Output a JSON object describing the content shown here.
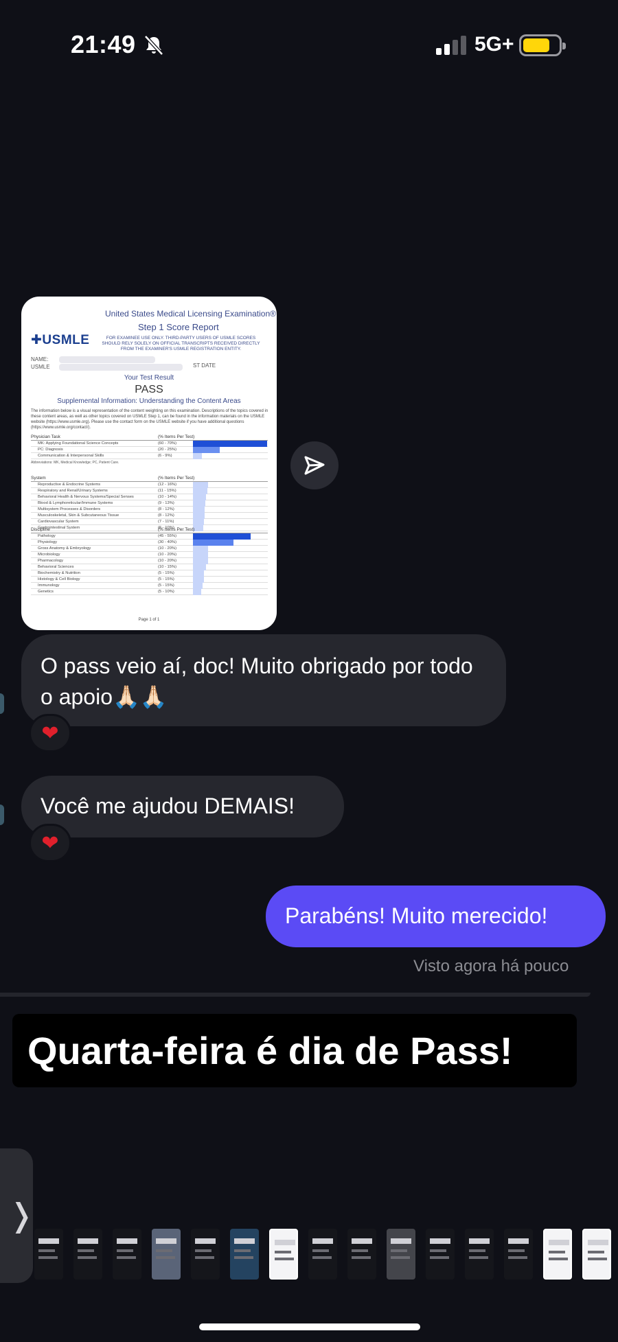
{
  "status_bar": {
    "time": "21:49",
    "network": "5G+",
    "mute_icon": "bell-slash-icon",
    "battery_color": "#ffd60a"
  },
  "attachment": {
    "title_line1": "United States Medical Licensing Examination®",
    "title_line2": "Step 1 Score Report",
    "logo": "USMLE",
    "warning": "FOR EXAMINEE USE ONLY. THIRD-PARTY USERS OF USMLE SCORES SHOULD RELY SOLELY ON OFFICIAL TRANSCRIPTS RECEIVED DIRECTLY FROM THE EXAMINER'S USMLE REGISTRATION ENTITY.",
    "name_label": "NAME:",
    "usmle_label": "USMLE",
    "date_label": "ST DATE",
    "your_test_result": "Your Test Result",
    "result": "PASS",
    "supplemental": "Supplemental Information: Understanding the Content Areas",
    "intro": "The information below is a visual representation of the content weighting on this examination. Descriptions of the topics covered in these content areas, as well as other topics covered on USMLE Step 1, can be found in the information materials on the USMLE website (https://www.usmle.org). Please use the contact form on the USMLE website if you have additional questions (https://www.usmle.org/contact/).",
    "sections": [
      {
        "heading": "Physician Task",
        "col": "(% Items Per Test)",
        "rows": [
          {
            "name": "MK: Applying Foundational Science Concepts",
            "range": "(60 - 70%)",
            "pct": 100,
            "color": "#1f4fd6"
          },
          {
            "name": "PC: Diagnosis",
            "range": "(20 - 25%)",
            "pct": 36,
            "color": "#6a8ff0"
          },
          {
            "name": "Communication & Interpersonal Skills",
            "range": "(6 - 9%)",
            "pct": 12,
            "color": "#c7d5fa"
          }
        ],
        "note": "Abbreviations: MK, Medical Knowledge; PC, Patient Care."
      },
      {
        "heading": "System",
        "col": "(% Items Per Test)",
        "rows": [
          {
            "name": "Reproductive & Endocrine Systems",
            "range": "(12 - 16%)",
            "pct": 20,
            "color": "#c7d5fa"
          },
          {
            "name": "Respiratory and Renal/Urinary Systems",
            "range": "(11 - 15%)",
            "pct": 19,
            "color": "#c7d5fa"
          },
          {
            "name": "Behavioral Health & Nervous Systems/Special Senses",
            "range": "(10 - 14%)",
            "pct": 18,
            "color": "#c7d5fa"
          },
          {
            "name": "Blood & Lymphoreticular/Immune Systems",
            "range": "(9 - 13%)",
            "pct": 17,
            "color": "#c7d5fa"
          },
          {
            "name": "Multisystem Processes & Disorders",
            "range": "(8 - 12%)",
            "pct": 16,
            "color": "#c7d5fa"
          },
          {
            "name": "Musculoskeletal, Skin & Subcutaneous Tissue",
            "range": "(8 - 12%)",
            "pct": 16,
            "color": "#c7d5fa"
          },
          {
            "name": "Cardiovascular System",
            "range": "(7 - 11%)",
            "pct": 15,
            "color": "#c7d5fa"
          },
          {
            "name": "Gastrointestinal System",
            "range": "(6 - 10%)",
            "pct": 14,
            "color": "#c7d5fa"
          }
        ]
      },
      {
        "heading": "Discipline",
        "col": "(% Items Per Test)",
        "rows": [
          {
            "name": "Pathology",
            "range": "(45 - 55%)",
            "pct": 78,
            "color": "#1f4fd6"
          },
          {
            "name": "Physiology",
            "range": "(30 - 40%)",
            "pct": 55,
            "color": "#5a82ee"
          },
          {
            "name": "Gross Anatomy & Embryology",
            "range": "(10 - 20%)",
            "pct": 20,
            "color": "#c7d5fa"
          },
          {
            "name": "Microbiology",
            "range": "(10 - 20%)",
            "pct": 20,
            "color": "#c7d5fa"
          },
          {
            "name": "Pharmacology",
            "range": "(10 - 20%)",
            "pct": 20,
            "color": "#c7d5fa"
          },
          {
            "name": "Behavioral Sciences",
            "range": "(10 - 15%)",
            "pct": 18,
            "color": "#c7d5fa"
          },
          {
            "name": "Biochemistry & Nutrition",
            "range": "(5 - 15%)",
            "pct": 15,
            "color": "#c7d5fa"
          },
          {
            "name": "Histology & Cell Biology",
            "range": "(5 - 15%)",
            "pct": 15,
            "color": "#c7d5fa"
          },
          {
            "name": "Immunology",
            "range": "(5 - 15%)",
            "pct": 13,
            "color": "#c7d5fa"
          },
          {
            "name": "Genetics",
            "range": "(5 - 10%)",
            "pct": 11,
            "color": "#c7d5fa"
          }
        ]
      }
    ],
    "page": "Page 1 of 1"
  },
  "share_icon": "send-icon",
  "messages": [
    {
      "side": "received",
      "text": "O pass veio aí, doc! Muito obrigado por todo o apoio🙏🏻🙏🏻",
      "reaction": "❤"
    },
    {
      "side": "received",
      "text": "Você me ajudou DEMAIS!",
      "reaction": "❤"
    },
    {
      "side": "sent",
      "text": "Parabéns! Muito merecido!"
    }
  ],
  "seen_status": "Visto agora há pouco",
  "caption": "Quarta-feira é dia de Pass!",
  "side_tab_icon": "chevron-right-icon",
  "thumbnails": [
    "dark",
    "dark",
    "dark",
    "photo",
    "dark",
    "blue",
    "light",
    "dark",
    "dark",
    "grey",
    "dark",
    "dark",
    "dark",
    "light",
    "light"
  ],
  "accent_colors": {
    "sent_bubble": "#5b4bf5",
    "received_bubble": "#26272e",
    "background": "#0f1017"
  }
}
